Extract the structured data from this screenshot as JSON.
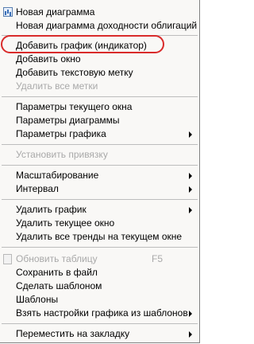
{
  "menu": {
    "items": [
      "Новая диаграмма",
      "Новая диаграмма доходности облигаций",
      "Добавить график (индикатор)",
      "Добавить окно",
      "Добавить текстовую метку",
      "Удалить все метки",
      "Параметры текущего окна",
      "Параметры диаграммы",
      "Параметры графика",
      "Установить привязку",
      "Масштабирование",
      "Интервал",
      "Удалить график",
      "Удалить текущее окно",
      "Удалить все тренды на текущем окне",
      "Обновить таблицу",
      "Сохранить в файл",
      "Сделать шаблоном",
      "Шаблоны",
      "Взять настройки графика из шаблонов",
      "Переместить на закладку"
    ],
    "shortcut_refresh": "F5",
    "icons": [
      "chart-icon",
      "refresh-table-icon"
    ],
    "disabled": [
      "Удалить все метки",
      "Установить привязку",
      "Обновить таблицу"
    ],
    "submenu": [
      "Параметры графика",
      "Масштабирование",
      "Интервал",
      "Удалить график",
      "Взять настройки графика из шаблонов",
      "Переместить на закладку"
    ]
  },
  "highlight_color": "#d92b2b"
}
